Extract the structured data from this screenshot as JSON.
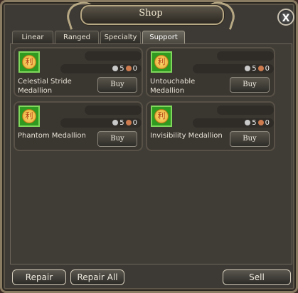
{
  "window": {
    "title": "Shop",
    "close_label": "X"
  },
  "tabs": [
    {
      "label": "Linear"
    },
    {
      "label": "Ranged"
    },
    {
      "label": "Specialty"
    },
    {
      "label": "Support",
      "active": true
    }
  ],
  "items": [
    {
      "name": "Celestial Stride Medallion",
      "silver": "5",
      "copper": "0",
      "buy_label": "Buy"
    },
    {
      "name": "Untouchable Medallion",
      "silver": "5",
      "copper": "0",
      "buy_label": "Buy"
    },
    {
      "name": "Phantom Medallion",
      "silver": "5",
      "copper": "0",
      "buy_label": "Buy"
    },
    {
      "name": "Invisibility Medallion",
      "silver": "5",
      "copper": "0",
      "buy_label": "Buy"
    }
  ],
  "item_icon_glyph": "利",
  "footer": {
    "repair_label": "Repair",
    "repair_all_label": "Repair All",
    "sell_label": "Sell"
  },
  "colors": {
    "accent_green": "#2f9a1f",
    "frame_gold": "#b7a884"
  }
}
